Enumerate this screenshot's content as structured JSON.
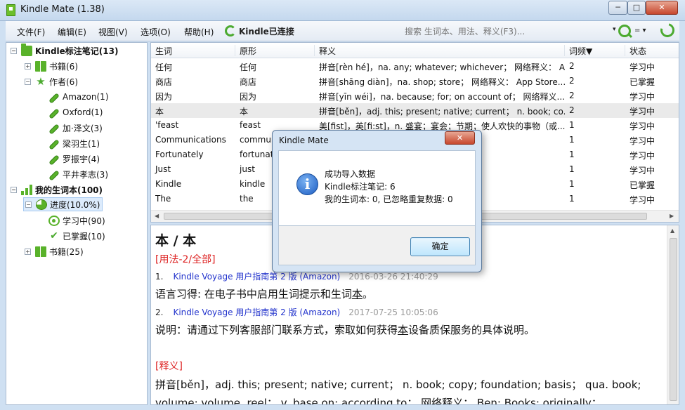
{
  "window": {
    "title": "Kindle Mate (1.38)",
    "min": "─",
    "max": "□",
    "close": "✕"
  },
  "menu": {
    "items": [
      "文件(F)",
      "编辑(E)",
      "视图(V)",
      "选项(O)",
      "帮助(H)"
    ],
    "status": "Kindle已连接",
    "search_placeholder": "搜索 生词本、用法、释义(F3)...",
    "search_dropdown": "▾",
    "search_option": "= ▾"
  },
  "tree": {
    "root_notes": "Kindle标注笔记(13)",
    "books": "书籍(6)",
    "authors": "作者(6)",
    "author_items": [
      "Amazon(1)",
      "Oxford(1)",
      "加·泽文(3)",
      "梁羽生(1)",
      "罗振宇(4)",
      "平井孝志(3)"
    ],
    "vocab_root": "我的生词本(100)",
    "progress": "进度(10.0%)",
    "learning": "学习中(90)",
    "mastered": "已掌握(10)",
    "vocab_books": "书籍(25)"
  },
  "table": {
    "headers": [
      "生词",
      "原形",
      "释义",
      "词频▼",
      "状态"
    ],
    "rows": [
      [
        "任何",
        "任何",
        "拼音[rèn hé]，na. any; whatever; whichever； 网络释义： A...",
        "2",
        "学习中"
      ],
      [
        "商店",
        "商店",
        "拼音[shāng diàn]，na. shop; store； 网络释义： App Store...",
        "2",
        "已掌握"
      ],
      [
        "因为",
        "因为",
        "拼音[yīn wéi]，na. because; for; on account of； 网络释义...",
        "2",
        "学习中"
      ],
      [
        "本",
        "本",
        "拼音[běn]，adj. this; present; native; current； n. book; co...",
        "2",
        "学习中"
      ],
      [
        "'feast",
        "feast",
        "美[fist]，英[fi:st]，n. 盛宴；宴会；节期；使人欢快的事物（或...",
        "1",
        "学习中"
      ],
      [
        "Communications",
        "communications",
        "n. 通讯，交通...",
        "1",
        "学习中"
      ],
      [
        "Fortunately",
        "fortunately",
        "adv. 幸运地；还好...",
        "1",
        "学习中"
      ],
      [
        "Just",
        "just",
        "adv. 只，刚才； adj. 公...",
        "1",
        "学习中"
      ],
      [
        "Kindle",
        "kindle",
        "vt. 燃烧；激起（兴趣...",
        "1",
        "已掌握"
      ],
      [
        "The",
        "the",
        "art. 用于比喻而喻的某事物； ...",
        "1",
        "学习中"
      ]
    ]
  },
  "detail": {
    "word": "本 / 本",
    "usage_header": "[用法-2/全部]",
    "usages": [
      {
        "num": "1.",
        "book": "Kindle Voyage 用户指南第 2 版 (Amazon)",
        "time": "2016-03-26 21:40:29",
        "before": "语言习得: 在电子书中启用生词提示和生词",
        "hl": "本",
        "after": "。"
      },
      {
        "num": "2.",
        "book": "Kindle Voyage 用户指南第 2 版 (Amazon)",
        "time": "2017-07-25 10:05:06",
        "before": "说明：请通过下列客服部门联系方式，索取如何获得",
        "hl": "本",
        "after": "设备质保服务的具体说明。"
      }
    ],
    "def_header": "[释义]",
    "def_lines": [
      "拼音[běn]，adj. this; present; native; current； n. book; copy; foundation; basis； qua. book;",
      "volume; volume, reel； v. base on; according to； 网络释义： Ben; Books; originally；"
    ]
  },
  "dialog": {
    "title": "Kindle Mate",
    "close": "✕",
    "icon": "i",
    "lines": [
      "成功导入数据",
      "Kindle标注笔记: 6",
      "我的生词本: 0, 已忽略重复数据: 0"
    ],
    "ok": "确定"
  }
}
